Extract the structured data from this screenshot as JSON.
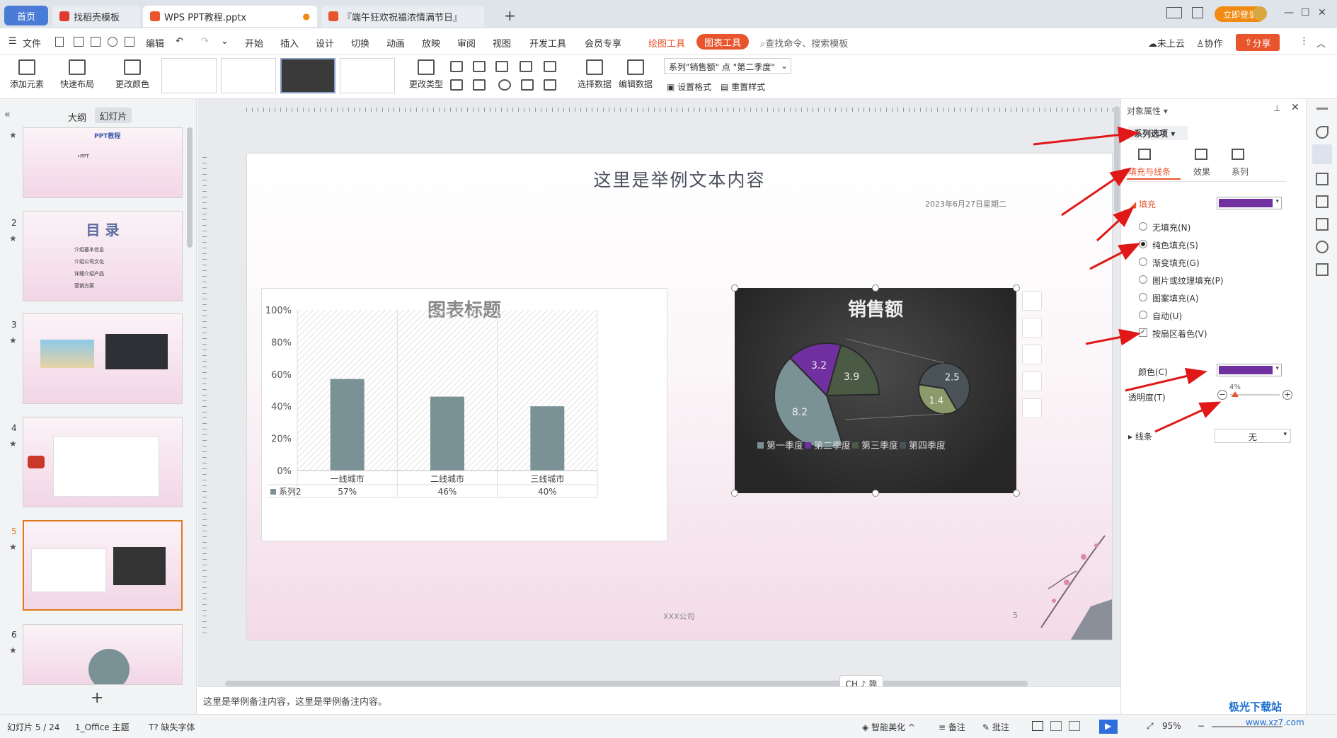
{
  "tabs": {
    "home": "首页",
    "find_template": "找稻壳模板",
    "doc": "WPS PPT教程.pptx",
    "doc2": "『端午狂欢祝福浓情满节日』",
    "login": "立即登录"
  },
  "menu": {
    "file": "文件",
    "edit": "编辑",
    "items": [
      "开始",
      "插入",
      "设计",
      "切换",
      "动画",
      "放映",
      "审阅",
      "视图",
      "开发工具",
      "会员专享"
    ],
    "draw_tools": "绘图工具",
    "chart_tools": "图表工具",
    "search": "查找命令、搜索模板",
    "cloud": "未上云",
    "collab": "协作",
    "share": "分享"
  },
  "ribbon": {
    "add_element": "添加元素",
    "quick_layout": "快速布局",
    "change_color": "更改颜色",
    "change_type": "更改类型",
    "select_data": "选择数据",
    "edit_data": "编辑数据",
    "series_select": "系列\"销售额\" 点 \"第二季度\"",
    "set_format": "设置格式",
    "reset_style": "重置样式"
  },
  "left_panel": {
    "outline_tab": "大纲",
    "slides_tab": "幻灯片",
    "slide_numbers": [
      "2",
      "3",
      "4",
      "5",
      "6"
    ],
    "thumb1_title": "PPT教程",
    "thumb1_text": "•PPT",
    "thumb2_title": "目 录",
    "thumb2_items": [
      "介绍基本信息",
      "介绍公司文化",
      "详细介绍产品",
      "营销方案"
    ]
  },
  "slide": {
    "title": "这里是举例文本内容",
    "date": "2023年6月27日星期二",
    "footer": "XXX公司",
    "page_number": "5"
  },
  "chart_data": [
    {
      "type": "bar",
      "title": "图表标题",
      "categories": [
        "一线城市",
        "二线城市",
        "三线城市"
      ],
      "series": [
        {
          "name": "系列2",
          "values": [
            57,
            46,
            40
          ]
        }
      ],
      "value_labels": [
        "57%",
        "46%",
        "40%"
      ],
      "ylim": [
        0,
        100
      ],
      "yticks": [
        "0%",
        "20%",
        "40%",
        "60%",
        "80%",
        "100%"
      ],
      "color": "#7a9196"
    },
    {
      "type": "pie",
      "title": "销售额",
      "categories": [
        "第一季度",
        "第二季度",
        "第三季度",
        "第四季度"
      ],
      "series": [
        {
          "name": "销售额",
          "values": [
            8.2,
            3.2,
            3.9,
            2.5,
            1.4
          ]
        }
      ],
      "colors": [
        "#7a9196",
        "#7030a0",
        "#4a5a44",
        "#4a5458",
        "#8a9a6a"
      ],
      "legend": "bottom"
    }
  ],
  "right_panel": {
    "header": "对象属性",
    "series_options": "系列选项",
    "tabs": [
      "填充与线条",
      "效果",
      "系列"
    ],
    "fill_label": "填充",
    "fill_options": [
      "无填充(N)",
      "纯色填充(S)",
      "渐变填充(G)",
      "图片或纹理填充(P)",
      "图案填充(A)",
      "自动(U)"
    ],
    "selected_fill": "纯色填充(S)",
    "vary_colors": "按扇区着色(V)",
    "color_label": "颜色(C)",
    "transparency_label": "透明度(T)",
    "transparency_value": "4%",
    "line_label": "线条",
    "line_value": "无",
    "accent_color": "#7030a0"
  },
  "notes": {
    "text": "这里是举例备注内容，这里是举例备注内容。",
    "ime": "CH ♪ 简"
  },
  "statusbar": {
    "slide_index": "幻灯片 5 / 24",
    "theme": "1_Office 主题",
    "missing_font": "缺失字体",
    "smart_beautify": "智能美化",
    "notes": "备注",
    "comments": "批注",
    "zoom": "95%"
  },
  "watermark": {
    "name": "极光下载站",
    "url": "www.xz7.com"
  }
}
